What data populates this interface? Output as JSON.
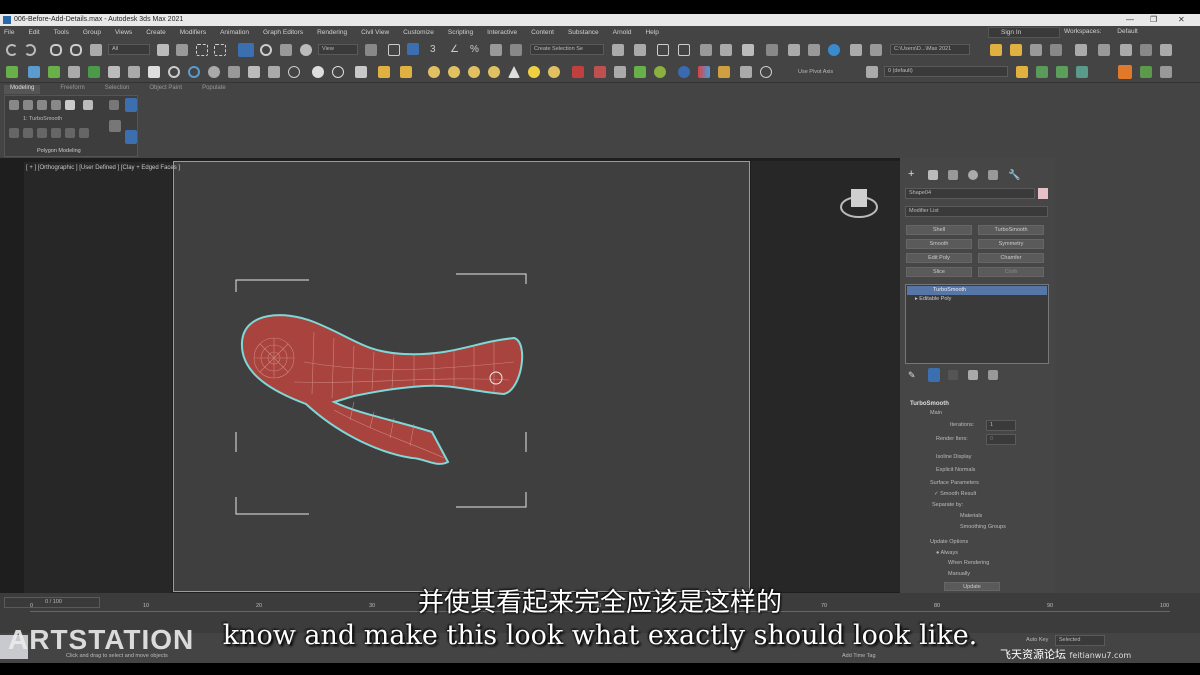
{
  "window": {
    "title": "006-Before-Add-Details.max - Autodesk 3ds Max 2021",
    "sign_in": "Sign In",
    "workspace_label": "Workspaces:",
    "workspace_value": "Default"
  },
  "menu": [
    "File",
    "Edit",
    "Tools",
    "Group",
    "Views",
    "Create",
    "Modifiers",
    "Animation",
    "Graph Editors",
    "Rendering",
    "Civil View",
    "Customize",
    "Scripting",
    "Interactive",
    "Content",
    "Substance",
    "Arnold",
    "Help"
  ],
  "toolbar": {
    "filter_value": "All",
    "view_value": "View",
    "selection_set_placeholder": "Create Selection Se",
    "project_path": "C:\\Users\\D...\\Max 2021",
    "use_pivot": "Use Pivot Axis",
    "layer_value": "0 (default)"
  },
  "ribbon": {
    "tabs": [
      "Modeling",
      "Freeform",
      "Selection",
      "Object Paint",
      "Populate"
    ],
    "active_tab": "Modeling",
    "panel_label": "Polygon Modeling",
    "stack_label": "1: TurboSmooth"
  },
  "viewport": {
    "label": "[ + ] [Orthographic ] [User Defined ] [Clay + Edged Faces ]"
  },
  "command_panel": {
    "object_name": "Shape04",
    "modifier_list": "Modifier List",
    "buttons": [
      "Shell",
      "TurboSmooth",
      "Smooth",
      "Symmetry",
      "Edit Poly",
      "Chamfer",
      "Slice",
      "Cloth"
    ],
    "stack": {
      "selected": "TurboSmooth",
      "base": "Editable Poly"
    },
    "rollout_title": "TurboSmooth",
    "main_label": "Main",
    "iterations_label": "Iterations:",
    "iterations_value": "1",
    "render_iters_label": "Render Iters:",
    "render_iters_value": "0",
    "isoline_display": "Isoline Display",
    "explicit_normals": "Explicit Normals",
    "surface_parameters": "Surface Parameters",
    "smooth_result": "Smooth Result",
    "separate_by": "Separate by:",
    "materials": "Materials",
    "smoothing_groups": "Smoothing Groups",
    "update_options": "Update Options",
    "always": "Always",
    "when_rendering": "When Rendering",
    "manually": "Manually",
    "update_button": "Update"
  },
  "timeline": {
    "frame_counter": "0 / 100",
    "ticks": [
      "0",
      "10",
      "20",
      "30",
      "40",
      "50",
      "60",
      "70",
      "80",
      "90",
      "100"
    ]
  },
  "status": {
    "prompt": "Click and drag to select and move objects",
    "add_time_tag": "Add Time Tag",
    "auto_key": "Auto Key",
    "selected": "Selected"
  },
  "overlay": {
    "subtitle_cn": "并使其看起来完全应该是这样的",
    "subtitle_en": "know and make this look what exactly should look like.",
    "artstation_logo": "ARTSTATION",
    "watermark_cn": "飞天资源论坛",
    "watermark_url": "feitianwu7.com"
  },
  "colors": {
    "viewport_frame": "#b8a032",
    "mesh_fill": "#a8433e",
    "mesh_outline": "#7fd8d8",
    "stack_highlight": "#5676a8"
  }
}
